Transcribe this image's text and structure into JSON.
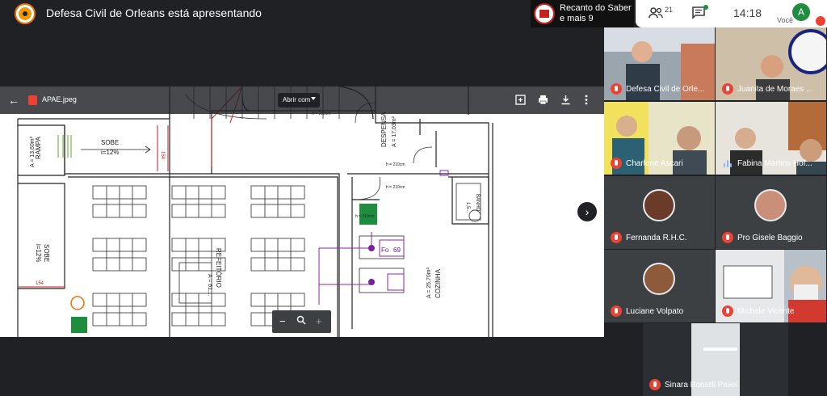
{
  "header": {
    "presenting_text": "Defesa Civil de Orleans está apresentando",
    "pinned_group_name": "Recanto do Saber e mais 9"
  },
  "toolbar": {
    "people_count": "21",
    "time": "14:18",
    "self_initial": "A",
    "self_label": "Você"
  },
  "viewer": {
    "file_name": "APAE.jpeg",
    "open_with_label": "Abrir com",
    "back_icon": "back-arrow-icon",
    "next_icon": "chevron-right-icon"
  },
  "participants": [
    {
      "name": "Defesa Civil de Orle..."
    },
    {
      "name": "Juanita de Moraes ..."
    },
    {
      "name": "Charlene Ascari"
    },
    {
      "name": "Fabina Martins Hof..."
    },
    {
      "name": "Fernanda R.H.C."
    },
    {
      "name": "Pro Gisele Baggio"
    },
    {
      "name": "Luciane Volpato"
    },
    {
      "name": "Michele Vicente"
    },
    {
      "name": "Sinara Bonetti Pavei"
    }
  ],
  "floorplan": {
    "labels": [
      "SOBE",
      "i=12%",
      "RAMPA",
      "A = 13,60m²",
      "SOBE",
      "i=12%",
      "154",
      "154",
      "DESPENSA",
      "A = 17,03m²",
      "COZINHA",
      "A = 25,70m²",
      "REFEITÓRIO",
      "A = 61,...",
      "BANHO",
      "1,5...",
      "Fo",
      "69",
      "h = 210cm",
      "h = 210cm",
      "h = 210cm",
      "h = 210cm"
    ]
  },
  "colors": {
    "bg": "#202124",
    "mic_off": "#ea4335",
    "speaking": "#8ab4f8",
    "self_avatar": "#1e8e3e"
  }
}
